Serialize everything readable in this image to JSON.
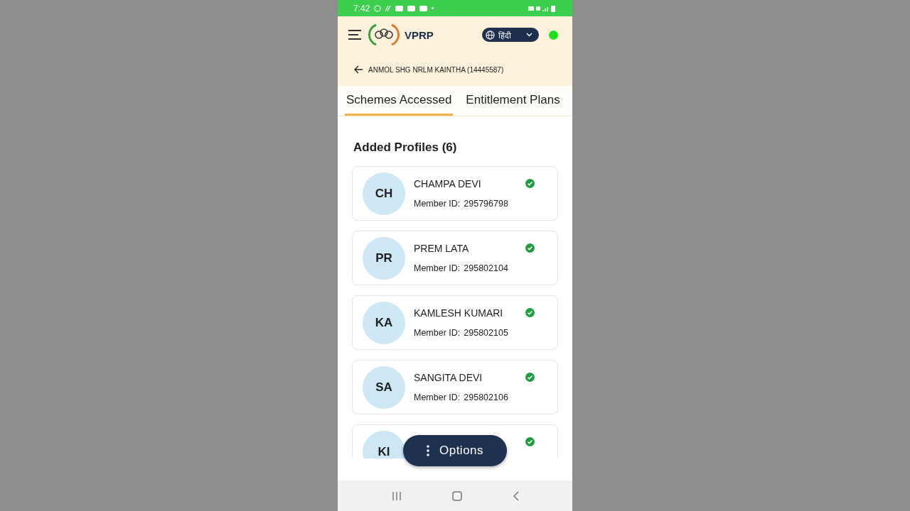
{
  "status_bar": {
    "time": "7:42"
  },
  "header": {
    "app_name": "VPRP",
    "language": "हिंदी",
    "online": true
  },
  "group": {
    "title": "ANMOL SHG NRLM KAINTHA (14445587)"
  },
  "tabs": [
    {
      "label": "Schemes Accessed",
      "selected": true
    },
    {
      "label": "Entitlement Plans",
      "selected": false
    }
  ],
  "section_title": "Added Profiles (6)",
  "profiles": [
    {
      "initials": "CH",
      "name": "CHAMPA DEVI",
      "member_id_label": "Member ID:",
      "member_id": "295796798",
      "verified": true
    },
    {
      "initials": "PR",
      "name": "PREM LATA",
      "member_id_label": "Member ID:",
      "member_id": "295802104",
      "verified": true
    },
    {
      "initials": "KA",
      "name": "KAMLESH KUMARI",
      "member_id_label": "Member ID:",
      "member_id": "295802105",
      "verified": true
    },
    {
      "initials": "SA",
      "name": "SANGITA DEVI",
      "member_id_label": "Member ID:",
      "member_id": "295802106",
      "verified": true
    },
    {
      "initials": "KI",
      "verified": true
    }
  ],
  "options_button": {
    "label": "Options"
  }
}
